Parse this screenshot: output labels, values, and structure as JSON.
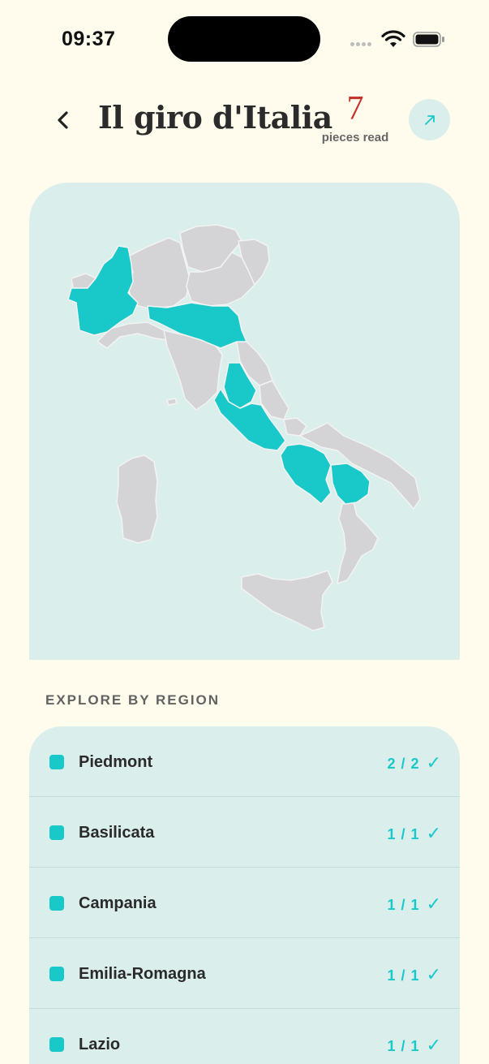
{
  "status_bar": {
    "time": "09:37"
  },
  "header": {
    "title": "Il giro d'Italia",
    "count": "7",
    "count_label": "pieces read"
  },
  "map": {
    "highlight_color": "#19c9c9",
    "inactive_color": "#d4d4d6",
    "water_color": "#daeeec",
    "highlighted_regions": [
      "Piedmont",
      "Emilia-Romagna",
      "Umbria",
      "Lazio",
      "Campania",
      "Basilicata"
    ]
  },
  "section": {
    "title": "EXPLORE BY REGION"
  },
  "regions": [
    {
      "name": "Piedmont",
      "progress": "2 / 2",
      "check": "✓"
    },
    {
      "name": "Basilicata",
      "progress": "1 / 1",
      "check": "✓"
    },
    {
      "name": "Campania",
      "progress": "1 / 1",
      "check": "✓"
    },
    {
      "name": "Emilia-Romagna",
      "progress": "1 / 1",
      "check": "✓"
    },
    {
      "name": "Lazio",
      "progress": "1 / 1",
      "check": "✓"
    }
  ]
}
